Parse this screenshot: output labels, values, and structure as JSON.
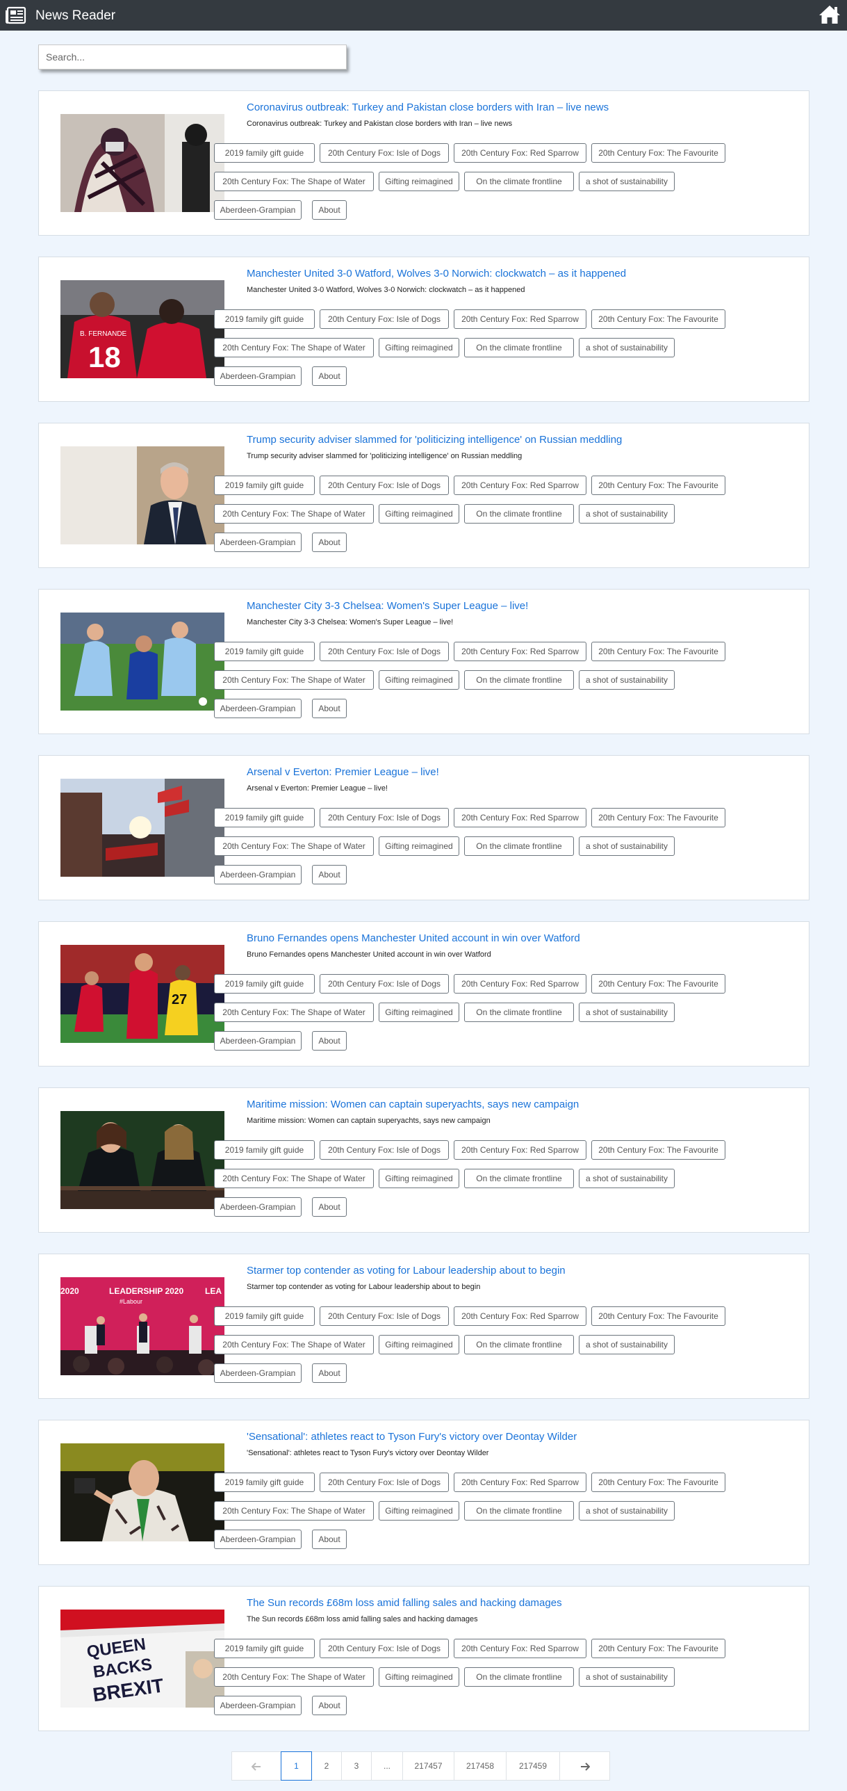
{
  "app": {
    "title": "News Reader",
    "logo_icon": "newspaper-icon",
    "home_icon": "home-icon"
  },
  "search": {
    "placeholder": "Search...",
    "value": ""
  },
  "tags": [
    "2019 family gift guide",
    "20th Century Fox: Isle of Dogs",
    "20th Century Fox: Red Sparrow",
    "20th Century Fox: The Favourite",
    "20th Century Fox: The Shape of Water",
    "Gifting reimagined",
    "On the climate frontline",
    "a shot of sustainability",
    "Aberdeen-Grampian",
    "About"
  ],
  "articles": [
    {
      "title": "Coronavirus outbreak: Turkey and Pakistan close borders with Iran – live news",
      "summary": "Coronavirus outbreak: Turkey and Pakistan close borders with Iran – live news",
      "image": "masked-women-photo"
    },
    {
      "title": "Manchester United 3-0 Watford, Wolves 3-0 Norwich: clockwatch – as it happened",
      "summary": "Manchester United 3-0 Watford, Wolves 3-0 Norwich: clockwatch – as it happened",
      "image": "football-players-photo",
      "image_text": "B. FERNANDE 18"
    },
    {
      "title": "Trump security adviser slammed for 'politicizing intelligence' on Russian meddling",
      "summary": "Trump security adviser slammed for 'politicizing intelligence' on Russian meddling",
      "image": "adviser-portrait-photo"
    },
    {
      "title": "Manchester City 3-3 Chelsea: Women's Super League – live!",
      "summary": "Manchester City 3-3 Chelsea: Women's Super League – live!",
      "image": "womens-football-photo"
    },
    {
      "title": "Arsenal v Everton: Premier League – live!",
      "summary": "Arsenal v Everton: Premier League – live!",
      "image": "stadium-street-photo"
    },
    {
      "title": "Bruno Fernandes opens Manchester United account in win over Watford",
      "summary": "Bruno Fernandes opens Manchester United account in win over Watford",
      "image": "goal-celebration-photo",
      "image_text": "27"
    },
    {
      "title": "Maritime mission: Women can captain superyachts, says new campaign",
      "summary": "Maritime mission: Women can captain superyachts, says new campaign",
      "image": "two-women-photo"
    },
    {
      "title": "Starmer top contender as voting for Labour leadership about to begin",
      "summary": "Starmer top contender as voting for Labour leadership about to begin",
      "image": "labour-hustings-photo",
      "image_text": "LEADERSHIP 2020 #Labour"
    },
    {
      "title": "'Sensational': athletes react to Tyson Fury's victory over Deontay Wilder",
      "summary": "'Sensational': athletes react to Tyson Fury's victory over Deontay Wilder",
      "image": "boxer-photo"
    },
    {
      "title": "The Sun records £68m loss amid falling sales and hacking damages",
      "summary": "The Sun records £68m loss amid falling sales and hacking damages",
      "image": "newspapers-photo",
      "image_text": "QUEEN BACKS BREXIT"
    }
  ],
  "pagination": {
    "prev_icon": "arrow-left-icon",
    "next_icon": "arrow-right-icon",
    "pages": [
      "1",
      "2",
      "3",
      "...",
      "217457",
      "217458",
      "217459"
    ],
    "current": "1"
  },
  "colors": {
    "topbar": "#343a40",
    "background": "#eef5fd",
    "link": "#1a73d9",
    "tag_border": "#6c757d"
  }
}
